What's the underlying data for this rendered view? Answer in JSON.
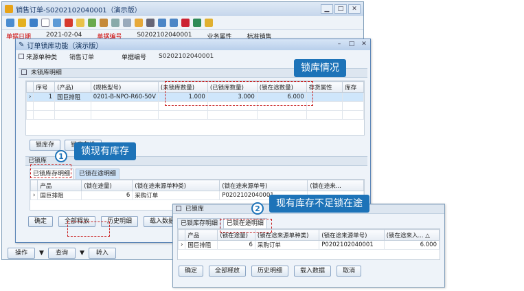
{
  "bg_window": {
    "title": "销售订单-S0202102040001（演示版）",
    "fields": [
      {
        "label": "单据日期",
        "value": "2021-02-04"
      },
      {
        "label": "单据编号",
        "value": "S0202102040001"
      },
      {
        "label": "业务属性",
        "value": "标准销售"
      }
    ],
    "bottom_buttons": [
      "操作",
      "查询",
      "转入"
    ]
  },
  "dialog": {
    "title": "订单锁库功能（演示版）",
    "source_type_label": "来源单种类",
    "source_type_value": "销售订单",
    "doc_no_label": "单据编号",
    "doc_no_value": "S0202102040001",
    "unlocked_section": "未锁库明细",
    "unlocked_columns": [
      "序号",
      "(产品)",
      "(规格型号)",
      "(未锁库数量)",
      "(已锁库数量)",
      "(锁在途数量)",
      "存货属性",
      "库存"
    ],
    "unlocked_row": {
      "index": "1",
      "product": "国巨排阻",
      "spec": "0201-B-NPO-R60-50V",
      "unlocked": "1.000",
      "locked": "3.000",
      "transit": "6.000"
    },
    "lock_stock_button": "锁库存",
    "lock_transit_button": "锁库在途",
    "locked_section": "已锁库",
    "tabs": [
      "已锁库存明细",
      "已锁在途明细"
    ],
    "locked_columns": [
      "产品",
      "(锁在途量)",
      "(锁在途来源单种类)",
      "(锁在途来源单号)",
      "(锁在途来..."
    ],
    "locked_row": {
      "product": "国巨排阻",
      "qty": "6",
      "src_type": "采购订单",
      "src_no": "P0202102040001"
    },
    "buttons": [
      "确定",
      "全部释放",
      "历史明细",
      "载入数据"
    ]
  },
  "dialog2": {
    "section": "已锁库",
    "tabs": [
      "已锁库存明细",
      "已锁在途明细"
    ],
    "columns": [
      "产品",
      "(锁在途量)",
      "(锁在途来源单种类)",
      "(锁在途来源单号)",
      "(锁在途来入... △"
    ],
    "row": {
      "product": "国巨排阻",
      "qty": "6",
      "src_type": "采购订单",
      "src_no": "P0202102040001",
      "value": "6.000"
    },
    "buttons": [
      "确定",
      "全部释放",
      "历史明细",
      "载入数据",
      "取消"
    ]
  },
  "callouts": {
    "lock_status": "锁库情况",
    "lock_stock": "锁现有库存",
    "lock_transit": "现有库存不足锁在途",
    "num1": "1",
    "num2": "2"
  },
  "colors": {
    "accent": "#1d73b8",
    "dash": "#c81e1e",
    "selected_row": "#cfe6fb"
  }
}
